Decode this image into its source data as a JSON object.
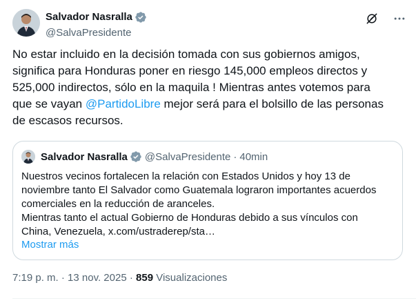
{
  "author": {
    "name": "Salvador Nasralla",
    "handle": "@SalvaPresidente"
  },
  "tweet": {
    "text_before_mention": "No estar incluido en la decisión tomada con sus gobiernos amigos,\nsignifica para Honduras poner en riesgo 145,000 empleos directos y\n525,000 indirectos, sólo en la maquila ! Mientras antes votemos para\nque se vayan ",
    "mention": "@PartidoLibre",
    "text_after_mention": " mejor será para el bolsillo de las personas\nde escasos recursos."
  },
  "quote": {
    "name": "Salvador Nasralla",
    "handle": "@SalvaPresidente",
    "separator": "·",
    "time": "40min",
    "text": "Nuestros vecinos fortalecen la relación con Estados Unidos y hoy 13 de\nnoviembre tanto El Salvador como Guatemala lograron importantes acuerdos\ncomerciales en la reducción de aranceles.\nMientras tanto el actual Gobierno de Honduras debido a sus vínculos con\nChina, Venezuela, x.com/ustraderep/sta…",
    "show_more": "Mostrar más"
  },
  "meta": {
    "time": "7:19 p. m.",
    "sep1": " · ",
    "date": "13 nov. 2025",
    "sep2": " · ",
    "views_count": "859",
    "views_label": " Visualizaciones"
  },
  "icons": {
    "verified": "verified-badge-icon",
    "grok": "grok-icon",
    "more": "more-icon"
  },
  "colors": {
    "accent": "#1d9bf0",
    "text": "#0f1419",
    "muted": "#536471",
    "border": "#cfd9de"
  }
}
